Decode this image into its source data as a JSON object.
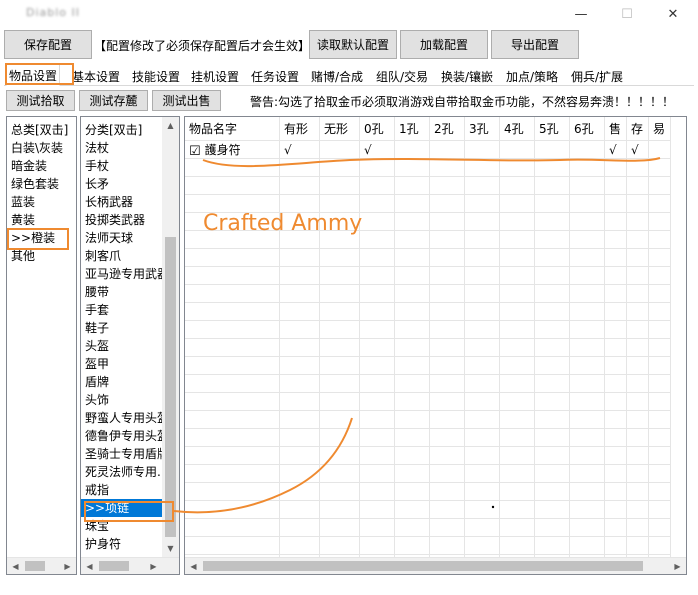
{
  "window": {
    "title": "Diablo II",
    "minimize_icon": "minimize-icon",
    "maximize_icon": "maximize-icon",
    "close_icon": "close-icon"
  },
  "toolbar": {
    "save_label": "保存配置",
    "notice": "【配置修改了必须保存配置后才会生效】",
    "load_default_label": "读取默认配置",
    "load_label": "加载配置",
    "export_label": "导出配置"
  },
  "tabs": [
    "物品设置",
    "基本设置",
    "技能设置",
    "挂机设置",
    "任务设置",
    "赌博/合成",
    "组队/交易",
    "换装/镶嵌",
    "加点/策略",
    "佣兵/扩展"
  ],
  "active_tab": "物品设置",
  "actions": {
    "test_pickup": "测试拾取",
    "test_stash": "测试存麓",
    "test_sell": "测试出售",
    "warning": "警告:勾选了拾取金币必须取消游戏自带拾取金币功能，不然容易奔溃！！！！！"
  },
  "category_list": {
    "header": "总类[双击]",
    "items": [
      "白装\\灰装",
      "暗金装",
      "绿色套装",
      "蓝装",
      "黄装",
      ">>橙装",
      "其他"
    ],
    "selected": ">>橙装"
  },
  "subcategory_list": {
    "header": "分类[双击]",
    "items": [
      "法杖",
      "手杖",
      "长矛",
      "长柄武器",
      "投掷类武器",
      "法师天球",
      "刺客爪",
      "亚马逊专用武器",
      "腰带",
      "手套",
      "鞋子",
      "头盔",
      "盔甲",
      "盾牌",
      "头饰",
      "野蛮人专用头盔",
      "德鲁伊专用头盔",
      "圣骑士专用盾牌",
      "死灵法师专用...",
      "戒指",
      ">>项链",
      "珠宝",
      "护身符"
    ],
    "selected": ">>项链"
  },
  "item_grid": {
    "columns": [
      "物品名字",
      "有形",
      "无形",
      "0孔",
      "1孔",
      "2孔",
      "3孔",
      "4孔",
      "5孔",
      "6孔",
      "售",
      "存",
      "易"
    ],
    "rows": [
      {
        "checked": true,
        "check_mark": "☑",
        "name": "護身符",
        "cells": [
          "√",
          "",
          "√",
          "",
          "",
          "",
          "",
          "",
          "",
          "√",
          "√",
          ""
        ]
      }
    ]
  },
  "annotation": {
    "text": "Crafted Ammy",
    "color": "#ef8a30"
  },
  "colors": {
    "accent_annotation": "#ef8a30",
    "selection": "#0078d7",
    "button_face": "#e1e1e1"
  }
}
